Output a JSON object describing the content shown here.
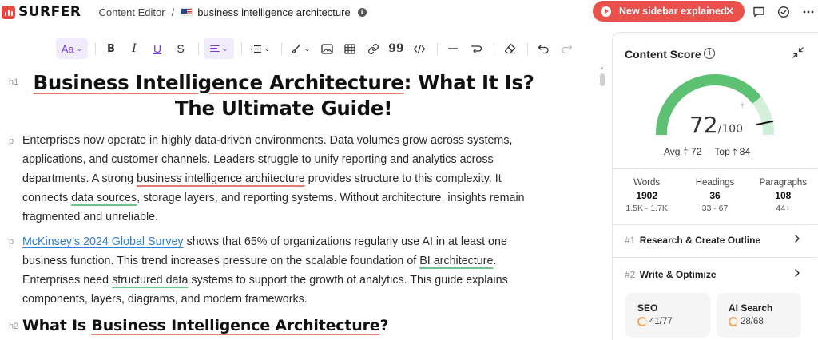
{
  "app": {
    "logo_text": "SURFER",
    "brand_color": "#e8473f"
  },
  "breadcrumb": {
    "section": "Content Editor",
    "separator": "/",
    "document": "business intelligence architecture",
    "flag": "us-flag-icon"
  },
  "banner": {
    "label": "New sidebar explained",
    "color": "#e9524c"
  },
  "top_icons": [
    "comment-icon",
    "check-circle-icon",
    "more-icon"
  ],
  "toolbar": {
    "text_style": "Aa",
    "tools": [
      "bold",
      "italic",
      "underline",
      "strikethrough",
      "align",
      "list",
      "highlight",
      "image",
      "table",
      "link",
      "quote",
      "code",
      "divider",
      "line-break",
      "clear-format",
      "undo",
      "redo"
    ]
  },
  "editor": {
    "h1_tag": "h1",
    "h1_line1_a": "Business Intelligence Architecture",
    "h1_line1_b": ": What It Is?",
    "h1_line2": "The Ultimate Guide!",
    "p_tag": "p",
    "p1": {
      "t1": "Enterprises now operate in highly data-driven environments. Data volumes grow across systems, applications, and customer channels. Leaders struggle to unify reporting and analytics across departments. A strong ",
      "k1": "business intelligence architecture",
      "t2": " provides structure to this complexity. It connects ",
      "k2": "data sources",
      "t3": ", storage layers, and reporting systems. Without architecture, insights remain fragmented and unreliable."
    },
    "p2": {
      "link": "McKinsey’s 2024 Global Survey",
      "t1": " shows that 65% of organizations regularly use AI in at least one business function. This trend increases pressure on the scalable foundation of ",
      "k1": "BI architecture",
      "t2": ". Enterprises need ",
      "k2": "structured data",
      "t3": " systems to support the growth of analytics. This guide explains components, layers, diagrams, and modern frameworks."
    },
    "h2_tag": "h2",
    "h2_a": "What Is ",
    "h2_b": "Business Intelligence Architecture",
    "h2_c": "?"
  },
  "sidebar": {
    "title": "Content Score",
    "score": 72,
    "score_value": "72",
    "score_max": "/100",
    "avg_label": "Avg",
    "avg_value": "72",
    "top_label": "Top",
    "top_value": "84",
    "gauge_colors": {
      "filled": "#5cc173",
      "light": "#d4f0da",
      "track": "#cfeed6"
    },
    "stats": [
      {
        "label": "Words",
        "value": "1902",
        "range": "1.5K - 1.7K"
      },
      {
        "label": "Headings",
        "value": "36",
        "range": "33 - 67"
      },
      {
        "label": "Paragraphs",
        "value": "108",
        "range": "44+"
      }
    ],
    "steps": [
      {
        "num": "#1",
        "label": "Research & Create Outline"
      },
      {
        "num": "#2",
        "label": "Write & Optimize"
      }
    ],
    "cards": [
      {
        "title": "SEO",
        "value": "41/77"
      },
      {
        "title": "AI Search",
        "value": "28/68"
      }
    ]
  }
}
